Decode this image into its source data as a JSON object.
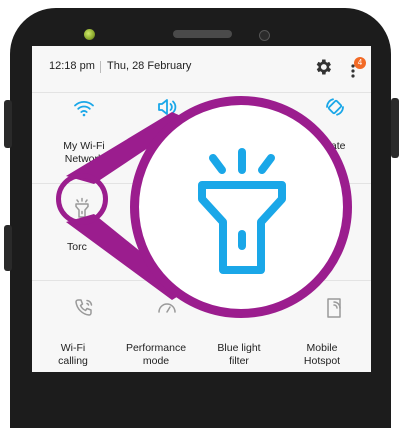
{
  "status_bar": {
    "time": "12:18 pm",
    "date": "Thu, 28 February",
    "notification_count": "4"
  },
  "quick_panel": {
    "row1": [
      {
        "icon": "wifi-icon",
        "label": "My Wi-Fi\nNetwork"
      },
      {
        "icon": "sound-icon",
        "label": ""
      },
      {
        "icon": "auto-rotate-icon",
        "label": "tate"
      }
    ],
    "row2": [
      {
        "icon": "torch-icon",
        "label": "Torc"
      }
    ],
    "row3": [
      {
        "icon": "wifi-calling-icon",
        "label": "Wi-Fi\ncalling"
      },
      {
        "icon": "performance-mode-icon",
        "label": "Performance\nmode"
      },
      {
        "icon": "blue-light-filter-icon",
        "label": "Blue light\nfilter"
      },
      {
        "icon": "mobile-hotspot-icon",
        "label": "Mobile\nHotspot"
      }
    ]
  },
  "colors": {
    "accent_active": "#1aa7e8",
    "magnifier": "#9b1d8e",
    "badge": "#f26a26",
    "inactive_icon": "#9a9a9a"
  }
}
